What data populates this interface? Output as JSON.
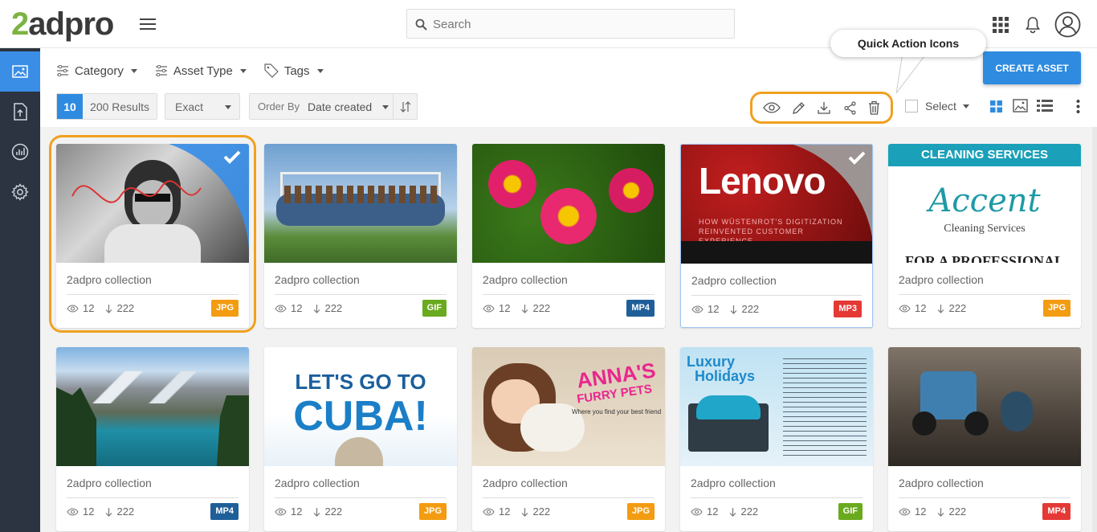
{
  "app": {
    "logo_prefix": "2",
    "logo_rest": "adpro"
  },
  "search": {
    "placeholder": "Search"
  },
  "filters": [
    {
      "label": "Category"
    },
    {
      "label": "Asset Type"
    },
    {
      "label": "Tags"
    }
  ],
  "results": {
    "count": "10",
    "text": "200 Results"
  },
  "match": {
    "value": "Exact"
  },
  "order": {
    "label": "Order By",
    "value": "Date created"
  },
  "create_label": "CREATE ASSET",
  "tooltip": "Quick Action Icons",
  "select_label": "Select",
  "colors": {
    "accent": "#2e8be0",
    "highlight": "#f0a020",
    "sidebar": "#2b3440",
    "jpg": "#f39c12",
    "gif": "#6aaa1e",
    "mp4": "#1f5f99",
    "mp3": "#e53935"
  },
  "assets": [
    {
      "name": "2adpro collection",
      "views": "12",
      "downloads": "222",
      "type": "JPG",
      "color": "#f39c12",
      "selected": true
    },
    {
      "name": "2adpro collection",
      "views": "12",
      "downloads": "222",
      "type": "GIF",
      "color": "#6aaa1e",
      "selected": false
    },
    {
      "name": "2adpro collection",
      "views": "12",
      "downloads": "222",
      "type": "MP4",
      "color": "#1f5f99",
      "selected": false
    },
    {
      "name": "2adpro collection",
      "views": "12",
      "downloads": "222",
      "type": "MP3",
      "color": "#e53935",
      "selected": true
    },
    {
      "name": "2adpro collection",
      "views": "12",
      "downloads": "222",
      "type": "JPG",
      "color": "#f39c12",
      "selected": false
    },
    {
      "name": "2adpro collection",
      "views": "12",
      "downloads": "222",
      "type": "MP4",
      "color": "#1f5f99",
      "selected": false
    },
    {
      "name": "2adpro collection",
      "views": "12",
      "downloads": "222",
      "type": "JPG",
      "color": "#f39c12",
      "selected": false
    },
    {
      "name": "2adpro collection",
      "views": "12",
      "downloads": "222",
      "type": "JPG",
      "color": "#f39c12",
      "selected": false
    },
    {
      "name": "2adpro collection",
      "views": "12",
      "downloads": "222",
      "type": "GIF",
      "color": "#6aaa1e",
      "selected": false
    },
    {
      "name": "2adpro collection",
      "views": "12",
      "downloads": "222",
      "type": "MP4",
      "color": "#e53935",
      "selected": false
    }
  ],
  "thumb_text": {
    "lenovo": "Lenovo",
    "lenovo_sub": "HOW WÜSTENROT'S DIGITIZATION REINVENTED CUSTOMER EXPERIENCE.",
    "cleaning": "CLEANING SERVICES",
    "accent": "Accent",
    "accent_sub": "Cleaning Services",
    "professional": "FOR A PROFESSIONAL",
    "cuba_top": "LET'S GO TO",
    "cuba": "CUBA!",
    "anna": "ANNA'S",
    "pets": "FURRY PETS",
    "pets_sub": "Where you find your best friend",
    "luxury": "Luxury",
    "holidays": "Holidays"
  }
}
